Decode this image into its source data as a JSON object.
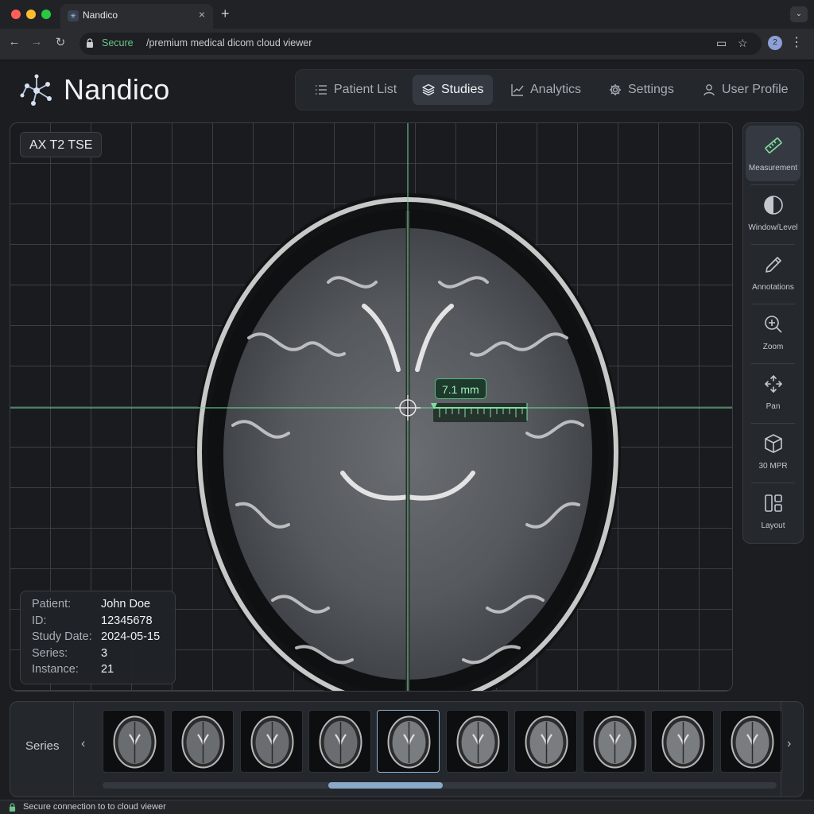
{
  "browser": {
    "tab_title": "Nandico",
    "url_secure": "Secure",
    "url_path": "/premium medical dicom cloud viewer",
    "profile_initial": "2",
    "status_text": "Secure connection to to cloud viewer"
  },
  "app": {
    "brand": "Nandico",
    "nav": [
      {
        "label": "Patient List",
        "icon": "list-icon",
        "active": false
      },
      {
        "label": "Studies",
        "icon": "layers-icon",
        "active": true
      },
      {
        "label": "Analytics",
        "icon": "chart-line-icon",
        "active": false
      },
      {
        "label": "Settings",
        "icon": "gear-icon",
        "active": false
      },
      {
        "label": "User Profile",
        "icon": "user-icon",
        "active": false
      }
    ]
  },
  "viewer": {
    "series_name": "AX T2 TSE",
    "measurement": "7.1 mm",
    "info": [
      {
        "key": "Patient:",
        "value": "John Doe"
      },
      {
        "key": "ID:",
        "value": "12345678"
      },
      {
        "key": "Study Date:",
        "value": "2024-05-15"
      },
      {
        "key": "Series:",
        "value": "3"
      },
      {
        "key": "Instance:",
        "value": "21"
      }
    ]
  },
  "toolbar": {
    "tools": [
      {
        "label": "Measurement",
        "icon": "ruler-icon",
        "active": true
      },
      {
        "label": "Window/Level",
        "icon": "contrast-icon",
        "active": false
      },
      {
        "label": "Annotations",
        "icon": "pencil-icon",
        "active": false
      },
      {
        "label": "Zoom",
        "icon": "zoom-in-icon",
        "active": false
      },
      {
        "label": "Pan",
        "icon": "move-icon",
        "active": false
      },
      {
        "label": "30 MPR",
        "icon": "cube-icon",
        "active": false
      },
      {
        "label": "Layout",
        "icon": "layout-icon",
        "active": false
      }
    ]
  },
  "series_strip": {
    "label": "Series",
    "thumbnail_count": 10,
    "selected_index": 4
  },
  "colors": {
    "accent_green": "#57b77a",
    "accent_blue": "#8aa9c8",
    "background": "#1b1d21"
  }
}
